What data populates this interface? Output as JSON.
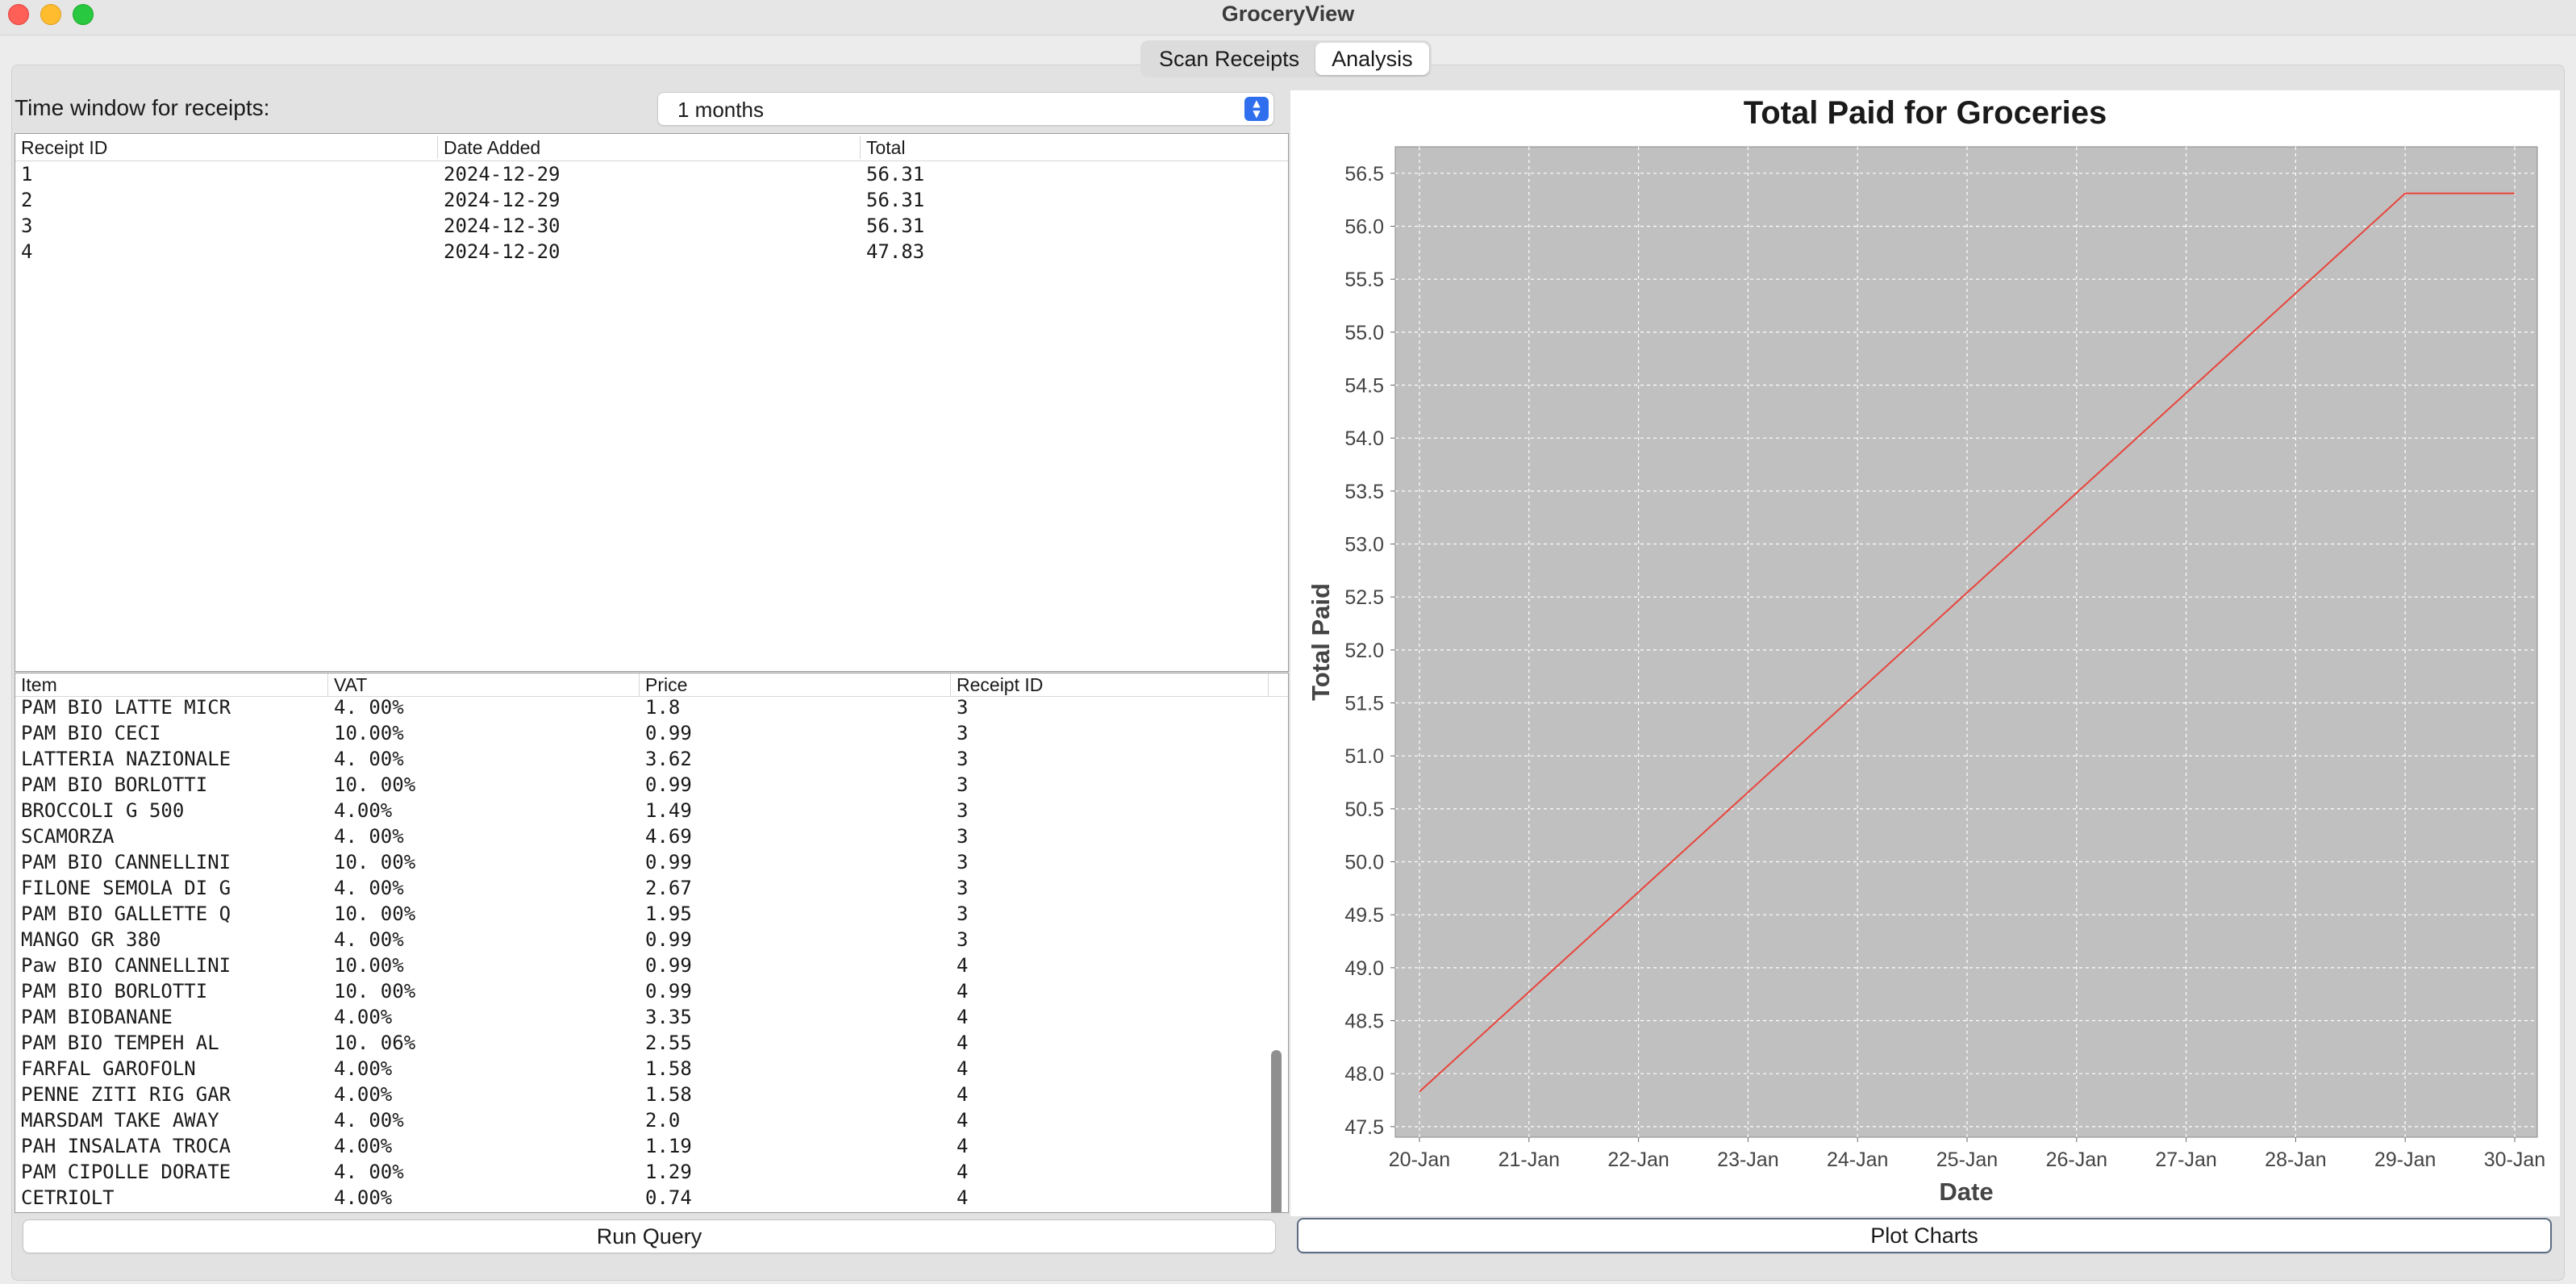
{
  "window": {
    "title": "GroceryView"
  },
  "tabs": [
    {
      "label": "Scan Receipts",
      "active": false
    },
    {
      "label": "Analysis",
      "active": true
    }
  ],
  "time_window": {
    "label": "Time window for receipts:",
    "value": "1 months"
  },
  "receipts_table": {
    "headers": [
      "Receipt ID",
      "Date Added",
      "Total"
    ],
    "rows": [
      [
        "1",
        "2024-12-29",
        "56.31"
      ],
      [
        "2",
        "2024-12-29",
        "56.31"
      ],
      [
        "3",
        "2024-12-30",
        "56.31"
      ],
      [
        "4",
        "2024-12-20",
        "47.83"
      ]
    ]
  },
  "items_table": {
    "headers": [
      "Item",
      "VAT",
      "Price",
      "Receipt ID"
    ],
    "rows": [
      [
        "PAM BIO LATTE MICR",
        "4. 00%",
        "1.8",
        "3"
      ],
      [
        "PAM BIO CECI",
        "10.00%",
        "0.99",
        "3"
      ],
      [
        "LATTERIA NAZIONALE",
        "4. 00%",
        "3.62",
        "3"
      ],
      [
        "PAM BIO BORLOTTI",
        "10. 00%",
        "0.99",
        "3"
      ],
      [
        "BROCCOLI G 500",
        "4.00%",
        "1.49",
        "3"
      ],
      [
        "SCAMORZA",
        "4. 00%",
        "4.69",
        "3"
      ],
      [
        "PAM BIO CANNELLINI",
        "10. 00%",
        "0.99",
        "3"
      ],
      [
        "FILONE SEMOLA DI G",
        "4. 00%",
        "2.67",
        "3"
      ],
      [
        "PAM BIO GALLETTE Q",
        "10. 00%",
        "1.95",
        "3"
      ],
      [
        "MANGO GR 380",
        "4. 00%",
        "0.99",
        "3"
      ],
      [
        "Paw BIO CANNELLINI",
        "10.00%",
        "0.99",
        "4"
      ],
      [
        "PAM BIO BORLOTTI",
        "10. 00%",
        "0.99",
        "4"
      ],
      [
        "PAM BIOBANANE",
        "4.00%",
        "3.35",
        "4"
      ],
      [
        "PAM BIO TEMPEH AL",
        "10. 06%",
        "2.55",
        "4"
      ],
      [
        "FARFAL GAROFOLN",
        "4.00%",
        "1.58",
        "4"
      ],
      [
        "PENNE ZITI RIG GAR",
        "4.00%",
        "1.58",
        "4"
      ],
      [
        "MARSDAM TAKE AWAY",
        "4. 00%",
        "2.0",
        "4"
      ],
      [
        "PAH INSALATA TROCA",
        "4.00%",
        "1.19",
        "4"
      ],
      [
        "PAM CIPOLLE DORATE",
        "4. 00%",
        "1.29",
        "4"
      ],
      [
        "CETRIOLT",
        "4.00%",
        "0.74",
        "4"
      ]
    ]
  },
  "buttons": {
    "run_query": "Run Query",
    "plot_charts": "Plot Charts"
  },
  "chart_data": {
    "type": "line",
    "title": "Total Paid for Groceries",
    "xlabel": "Date",
    "ylabel": "Total Paid",
    "x_ticks": [
      "20-Jan",
      "21-Jan",
      "22-Jan",
      "23-Jan",
      "24-Jan",
      "25-Jan",
      "26-Jan",
      "27-Jan",
      "28-Jan",
      "29-Jan",
      "30-Jan"
    ],
    "y_ticks": [
      47.5,
      48.0,
      48.5,
      49.0,
      49.5,
      50.0,
      50.5,
      51.0,
      51.5,
      52.0,
      52.5,
      53.0,
      53.5,
      54.0,
      54.5,
      55.0,
      55.5,
      56.0,
      56.5
    ],
    "ylim": [
      47.4,
      56.75
    ],
    "xlim": [
      "20-Jan",
      "30-Jan"
    ],
    "grid": true,
    "plot_background": "#c0c0c0",
    "series": [
      {
        "color": "#e8453c",
        "x": [
          "20-Jan",
          "29-Jan",
          "30-Jan"
        ],
        "y": [
          47.83,
          56.31,
          56.31
        ]
      }
    ]
  }
}
